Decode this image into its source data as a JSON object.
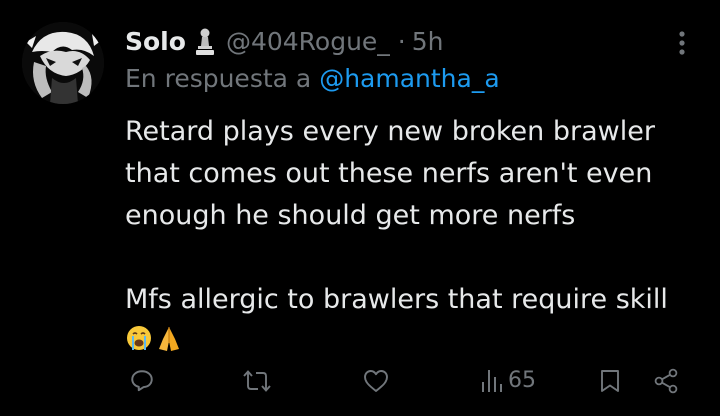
{
  "tweet": {
    "display_name": "Solo",
    "badge_icon": "chess-pawn-icon",
    "handle": "@404Rogue_",
    "separator": "·",
    "time": "5h",
    "reply_prefix": "En respuesta a",
    "reply_mention": "@hamantha_a",
    "body_lines": [
      "Retard plays every new broken brawler that comes out these nerfs aren't even enough he should get more nerfs",
      "Mfs allergic to brawlers that require skill"
    ],
    "emojis": [
      "crying-face-emoji",
      "folded-hands-emoji"
    ]
  },
  "actions": {
    "reply_icon": "reply-icon",
    "retweet_icon": "retweet-icon",
    "like_icon": "heart-icon",
    "views_icon": "views-icon",
    "views_count": "65",
    "bookmark_icon": "bookmark-icon",
    "share_icon": "share-icon"
  },
  "colors": {
    "background": "#000000",
    "text_primary": "#e7e9ea",
    "text_secondary": "#71767b",
    "accent": "#1d9bf0"
  }
}
